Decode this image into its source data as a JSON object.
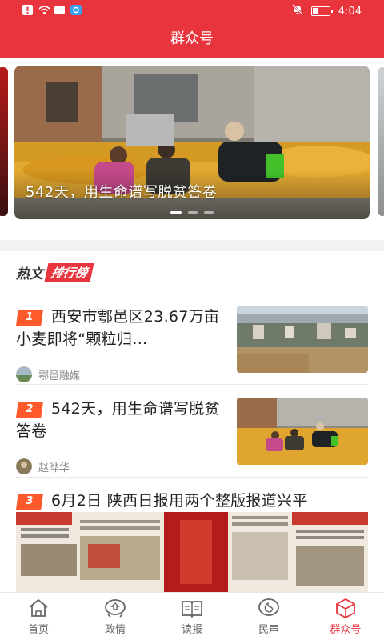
{
  "statusbar": {
    "time": "4:04"
  },
  "navbar": {
    "title": "群众号"
  },
  "carousel": {
    "caption": "542天，用生命谱写脱贫答卷",
    "dots": 3,
    "active_dot": 1
  },
  "hot_header": {
    "part1": "热文",
    "part2": "排行榜"
  },
  "articles": [
    {
      "rank": "1",
      "title": "西安市鄠邑区23.67万亩小麦即将“颗粒归…",
      "author": "鄠邑融媒"
    },
    {
      "rank": "2",
      "title": "542天，用生命谱写脱贫答卷",
      "author": "赵晔华"
    },
    {
      "rank": "3",
      "title": "6月2日 陕西日报用两个整版报道兴平"
    }
  ],
  "tabs": [
    {
      "label": "首页",
      "icon": "home-icon",
      "active": false
    },
    {
      "label": "政情",
      "icon": "politics-icon",
      "active": false
    },
    {
      "label": "读报",
      "icon": "newspaper-icon",
      "active": false
    },
    {
      "label": "民声",
      "icon": "voice-icon",
      "active": false
    },
    {
      "label": "群众号",
      "icon": "cube-icon",
      "active": true
    }
  ],
  "colors": {
    "brand": "#e8353d",
    "rank_badge": "#ff5a2b"
  }
}
